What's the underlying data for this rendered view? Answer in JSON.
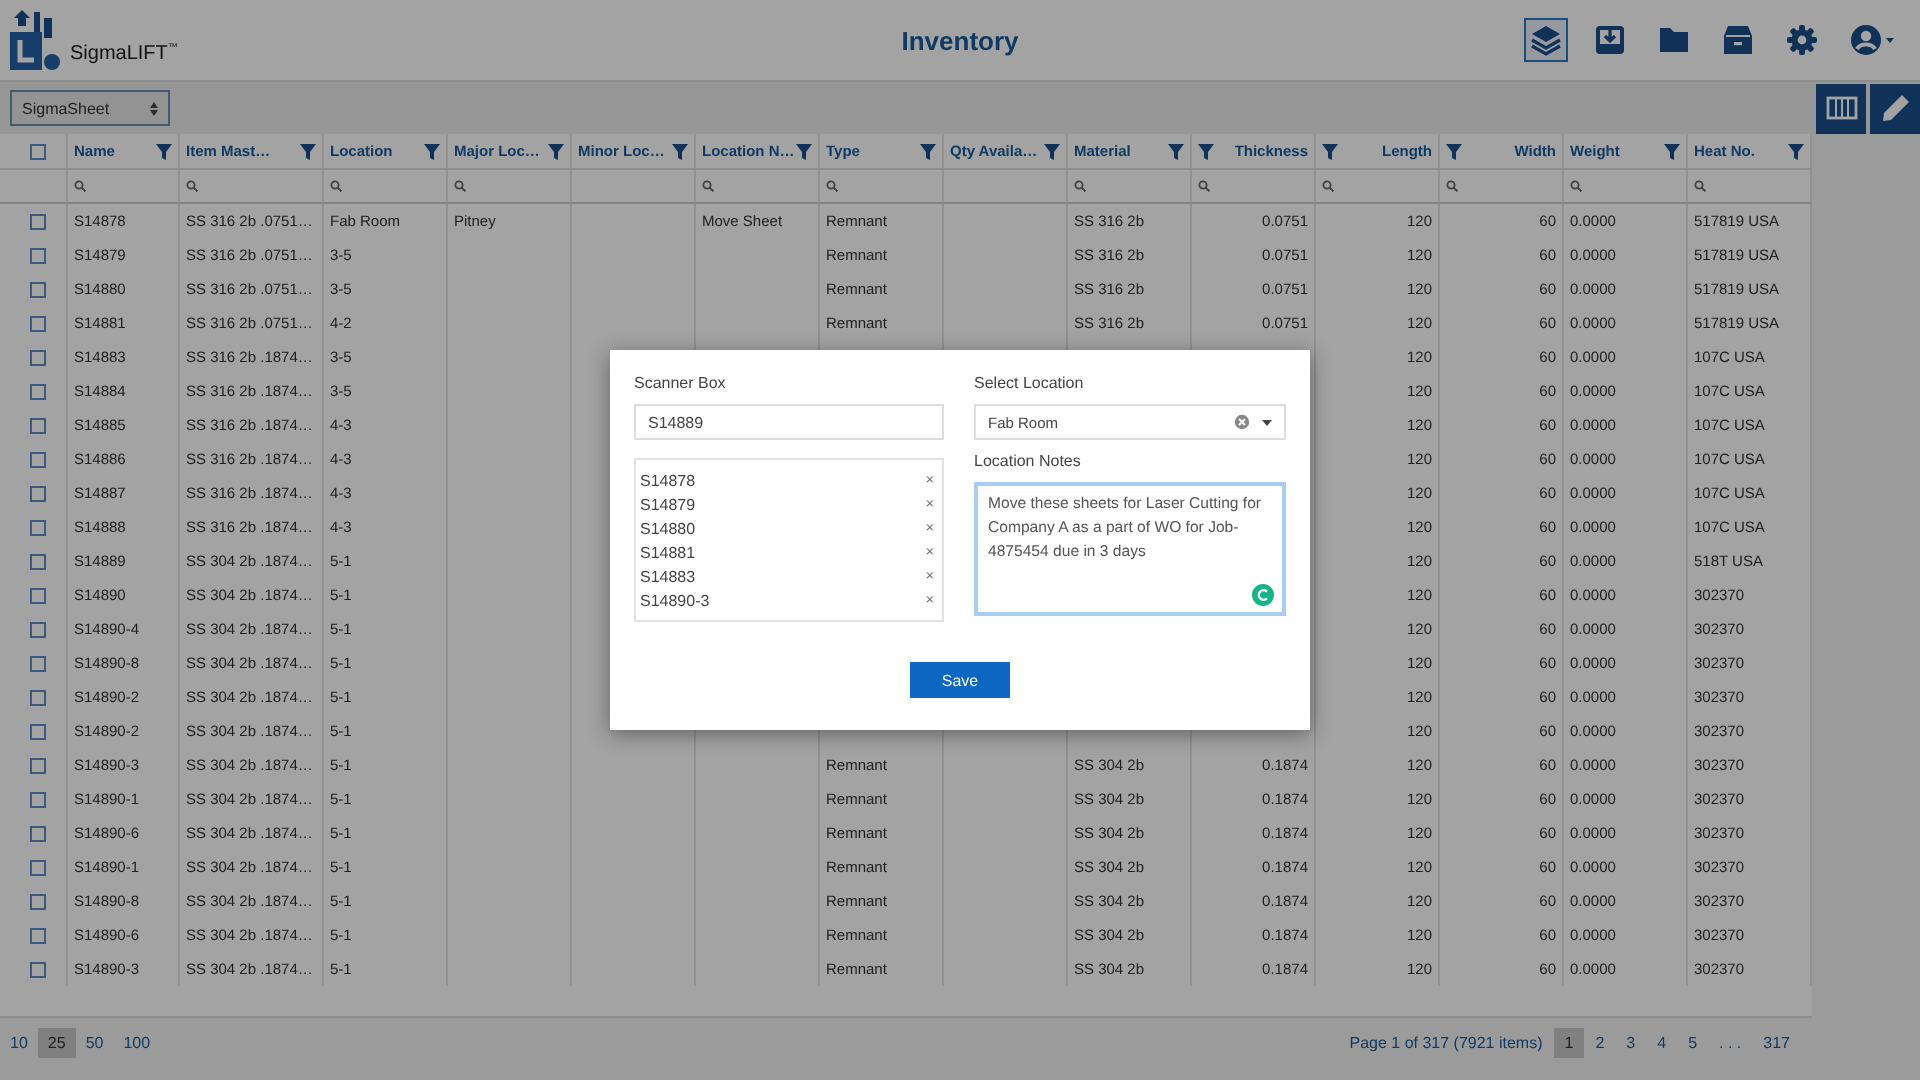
{
  "app": {
    "name": "SigmaLIFT",
    "mark": "™"
  },
  "page_title": "Inventory",
  "nav_icons": [
    {
      "kind": "layers",
      "selected": true
    },
    {
      "kind": "download",
      "selected": false
    },
    {
      "kind": "folder",
      "selected": false
    },
    {
      "kind": "archive",
      "selected": false
    },
    {
      "kind": "settings",
      "selected": false
    },
    {
      "kind": "user",
      "selected": false
    }
  ],
  "view_select": {
    "value": "SigmaSheet"
  },
  "tool_buttons": [
    {
      "kind": "columns"
    },
    {
      "kind": "edit"
    }
  ],
  "table": {
    "all_checked": false,
    "columns": [
      {
        "label": "Name",
        "kind": "text",
        "searchable": true
      },
      {
        "label": "Item Mast…",
        "kind": "text",
        "searchable": true
      },
      {
        "label": "Location",
        "kind": "text",
        "searchable": true
      },
      {
        "label": "Major Loc…",
        "kind": "text",
        "searchable": true
      },
      {
        "label": "Minor Loc…",
        "kind": "text",
        "searchable": false
      },
      {
        "label": "Location N…",
        "kind": "text",
        "searchable": true
      },
      {
        "label": "Type",
        "kind": "text",
        "searchable": true
      },
      {
        "label": "Qty Availa…",
        "kind": "text",
        "searchable": false
      },
      {
        "label": "Material",
        "kind": "text",
        "searchable": true
      },
      {
        "label": "Thickness",
        "kind": "number",
        "searchable": true
      },
      {
        "label": "Length",
        "kind": "number",
        "searchable": true
      },
      {
        "label": "Width",
        "kind": "number",
        "searchable": true
      },
      {
        "label": "Weight",
        "kind": "text",
        "searchable": true
      },
      {
        "label": "Heat No.",
        "kind": "text",
        "searchable": true
      }
    ],
    "rows": [
      {
        "checked": false,
        "cells": [
          "S14878",
          "SS 316 2b .0751…",
          "Fab Room",
          "Pitney",
          null,
          "Move Sheet",
          "Remnant",
          null,
          "SS 316 2b",
          "0.0751",
          "120",
          "60",
          "0.0000",
          "517819 USA"
        ]
      },
      {
        "checked": false,
        "cells": [
          "S14879",
          "SS 316 2b .0751…",
          "3-5",
          null,
          null,
          null,
          "Remnant",
          null,
          "SS 316 2b",
          "0.0751",
          "120",
          "60",
          "0.0000",
          "517819 USA"
        ]
      },
      {
        "checked": false,
        "cells": [
          "S14880",
          "SS 316 2b .0751…",
          "3-5",
          null,
          null,
          null,
          "Remnant",
          null,
          "SS 316 2b",
          "0.0751",
          "120",
          "60",
          "0.0000",
          "517819 USA"
        ]
      },
      {
        "checked": false,
        "cells": [
          "S14881",
          "SS 316 2b .0751…",
          "4-2",
          null,
          null,
          null,
          "Remnant",
          null,
          "SS 316 2b",
          "0.0751",
          "120",
          "60",
          "0.0000",
          "517819 USA"
        ]
      },
      {
        "checked": false,
        "cells": [
          "S14883",
          "SS 316 2b .1874…",
          "3-5",
          null,
          null,
          null,
          null,
          null,
          null,
          null,
          "120",
          "60",
          "0.0000",
          "107C USA"
        ]
      },
      {
        "checked": false,
        "cells": [
          "S14884",
          "SS 316 2b .1874…",
          "3-5",
          null,
          null,
          null,
          null,
          null,
          null,
          null,
          "120",
          "60",
          "0.0000",
          "107C USA"
        ]
      },
      {
        "checked": false,
        "cells": [
          "S14885",
          "SS 316 2b .1874…",
          "4-3",
          null,
          null,
          null,
          null,
          null,
          null,
          null,
          "120",
          "60",
          "0.0000",
          "107C USA"
        ]
      },
      {
        "checked": false,
        "cells": [
          "S14886",
          "SS 316 2b .1874…",
          "4-3",
          null,
          null,
          null,
          null,
          null,
          null,
          null,
          "120",
          "60",
          "0.0000",
          "107C USA"
        ]
      },
      {
        "checked": false,
        "cells": [
          "S14887",
          "SS 316 2b .1874…",
          "4-3",
          null,
          null,
          null,
          null,
          null,
          null,
          null,
          "120",
          "60",
          "0.0000",
          "107C USA"
        ]
      },
      {
        "checked": false,
        "cells": [
          "S14888",
          "SS 316 2b .1874…",
          "4-3",
          null,
          null,
          null,
          null,
          null,
          null,
          null,
          "120",
          "60",
          "0.0000",
          "107C USA"
        ]
      },
      {
        "checked": false,
        "cells": [
          "S14889",
          "SS 304 2b .1874…",
          "5-1",
          null,
          null,
          null,
          null,
          null,
          null,
          null,
          "120",
          "60",
          "0.0000",
          "518T USA"
        ]
      },
      {
        "checked": false,
        "cells": [
          "S14890",
          "SS 304 2b .1874…",
          "5-1",
          null,
          null,
          null,
          null,
          null,
          null,
          null,
          "120",
          "60",
          "0.0000",
          "302370"
        ]
      },
      {
        "checked": false,
        "cells": [
          "S14890-4",
          "SS 304 2b .1874…",
          "5-1",
          null,
          null,
          null,
          null,
          null,
          null,
          null,
          "120",
          "60",
          "0.0000",
          "302370"
        ]
      },
      {
        "checked": false,
        "cells": [
          "S14890-8",
          "SS 304 2b .1874…",
          "5-1",
          null,
          null,
          null,
          null,
          null,
          null,
          null,
          "120",
          "60",
          "0.0000",
          "302370"
        ]
      },
      {
        "checked": false,
        "cells": [
          "S14890-2",
          "SS 304 2b .1874…",
          "5-1",
          null,
          null,
          null,
          null,
          null,
          null,
          null,
          "120",
          "60",
          "0.0000",
          "302370"
        ]
      },
      {
        "checked": false,
        "cells": [
          "S14890-2",
          "SS 304 2b .1874…",
          "5-1",
          null,
          null,
          null,
          null,
          null,
          null,
          null,
          "120",
          "60",
          "0.0000",
          "302370"
        ]
      },
      {
        "checked": false,
        "cells": [
          "S14890-3",
          "SS 304 2b .1874…",
          "5-1",
          null,
          null,
          null,
          "Remnant",
          null,
          "SS 304 2b",
          "0.1874",
          "120",
          "60",
          "0.0000",
          "302370"
        ]
      },
      {
        "checked": false,
        "cells": [
          "S14890-1",
          "SS 304 2b .1874…",
          "5-1",
          null,
          null,
          null,
          "Remnant",
          null,
          "SS 304 2b",
          "0.1874",
          "120",
          "60",
          "0.0000",
          "302370"
        ]
      },
      {
        "checked": false,
        "cells": [
          "S14890-6",
          "SS 304 2b .1874…",
          "5-1",
          null,
          null,
          null,
          "Remnant",
          null,
          "SS 304 2b",
          "0.1874",
          "120",
          "60",
          "0.0000",
          "302370"
        ]
      },
      {
        "checked": false,
        "cells": [
          "S14890-1",
          "SS 304 2b .1874…",
          "5-1",
          null,
          null,
          null,
          "Remnant",
          null,
          "SS 304 2b",
          "0.1874",
          "120",
          "60",
          "0.0000",
          "302370"
        ]
      },
      {
        "checked": false,
        "cells": [
          "S14890-8",
          "SS 304 2b .1874…",
          "5-1",
          null,
          null,
          null,
          "Remnant",
          null,
          "SS 304 2b",
          "0.1874",
          "120",
          "60",
          "0.0000",
          "302370"
        ]
      },
      {
        "checked": false,
        "cells": [
          "S14890-6",
          "SS 304 2b .1874…",
          "5-1",
          null,
          null,
          null,
          "Remnant",
          null,
          "SS 304 2b",
          "0.1874",
          "120",
          "60",
          "0.0000",
          "302370"
        ]
      },
      {
        "checked": false,
        "cells": [
          "S14890-3",
          "SS 304 2b .1874…",
          "5-1",
          null,
          null,
          null,
          "Remnant",
          null,
          "SS 304 2b",
          "0.1874",
          "120",
          "60",
          "0.0000",
          "302370"
        ]
      }
    ]
  },
  "pagination": {
    "page_sizes": [
      {
        "label": "10",
        "selected": false
      },
      {
        "label": "25",
        "selected": true
      },
      {
        "label": "50",
        "selected": false
      },
      {
        "label": "100",
        "selected": false
      }
    ],
    "summary": "Page 1 of 317 (7921 items)",
    "pages": [
      {
        "label": "1",
        "selected": true
      },
      {
        "label": "2",
        "selected": false
      },
      {
        "label": "3",
        "selected": false
      },
      {
        "label": "4",
        "selected": false
      },
      {
        "label": "5",
        "selected": false
      },
      {
        "label": ". . .",
        "selected": false
      },
      {
        "label": "317",
        "selected": false
      }
    ]
  },
  "modal": {
    "scanner_label": "Scanner Box",
    "scanner_value": "S14889",
    "scanned_items": [
      {
        "label": "S14878",
        "remove": "×"
      },
      {
        "label": "S14879",
        "remove": "×"
      },
      {
        "label": "S14880",
        "remove": "×"
      },
      {
        "label": "S14881",
        "remove": "×"
      },
      {
        "label": "S14883",
        "remove": "×"
      },
      {
        "label": "S14890-3",
        "remove": "×"
      }
    ],
    "location_label": "Select Location",
    "location_value": "Fab Room",
    "notes_label": "Location Notes",
    "notes_value": "Move these sheets for Laser Cutting for Company A as a part of WO for Job-4875454 due in 3 days",
    "save_label": "Save"
  }
}
